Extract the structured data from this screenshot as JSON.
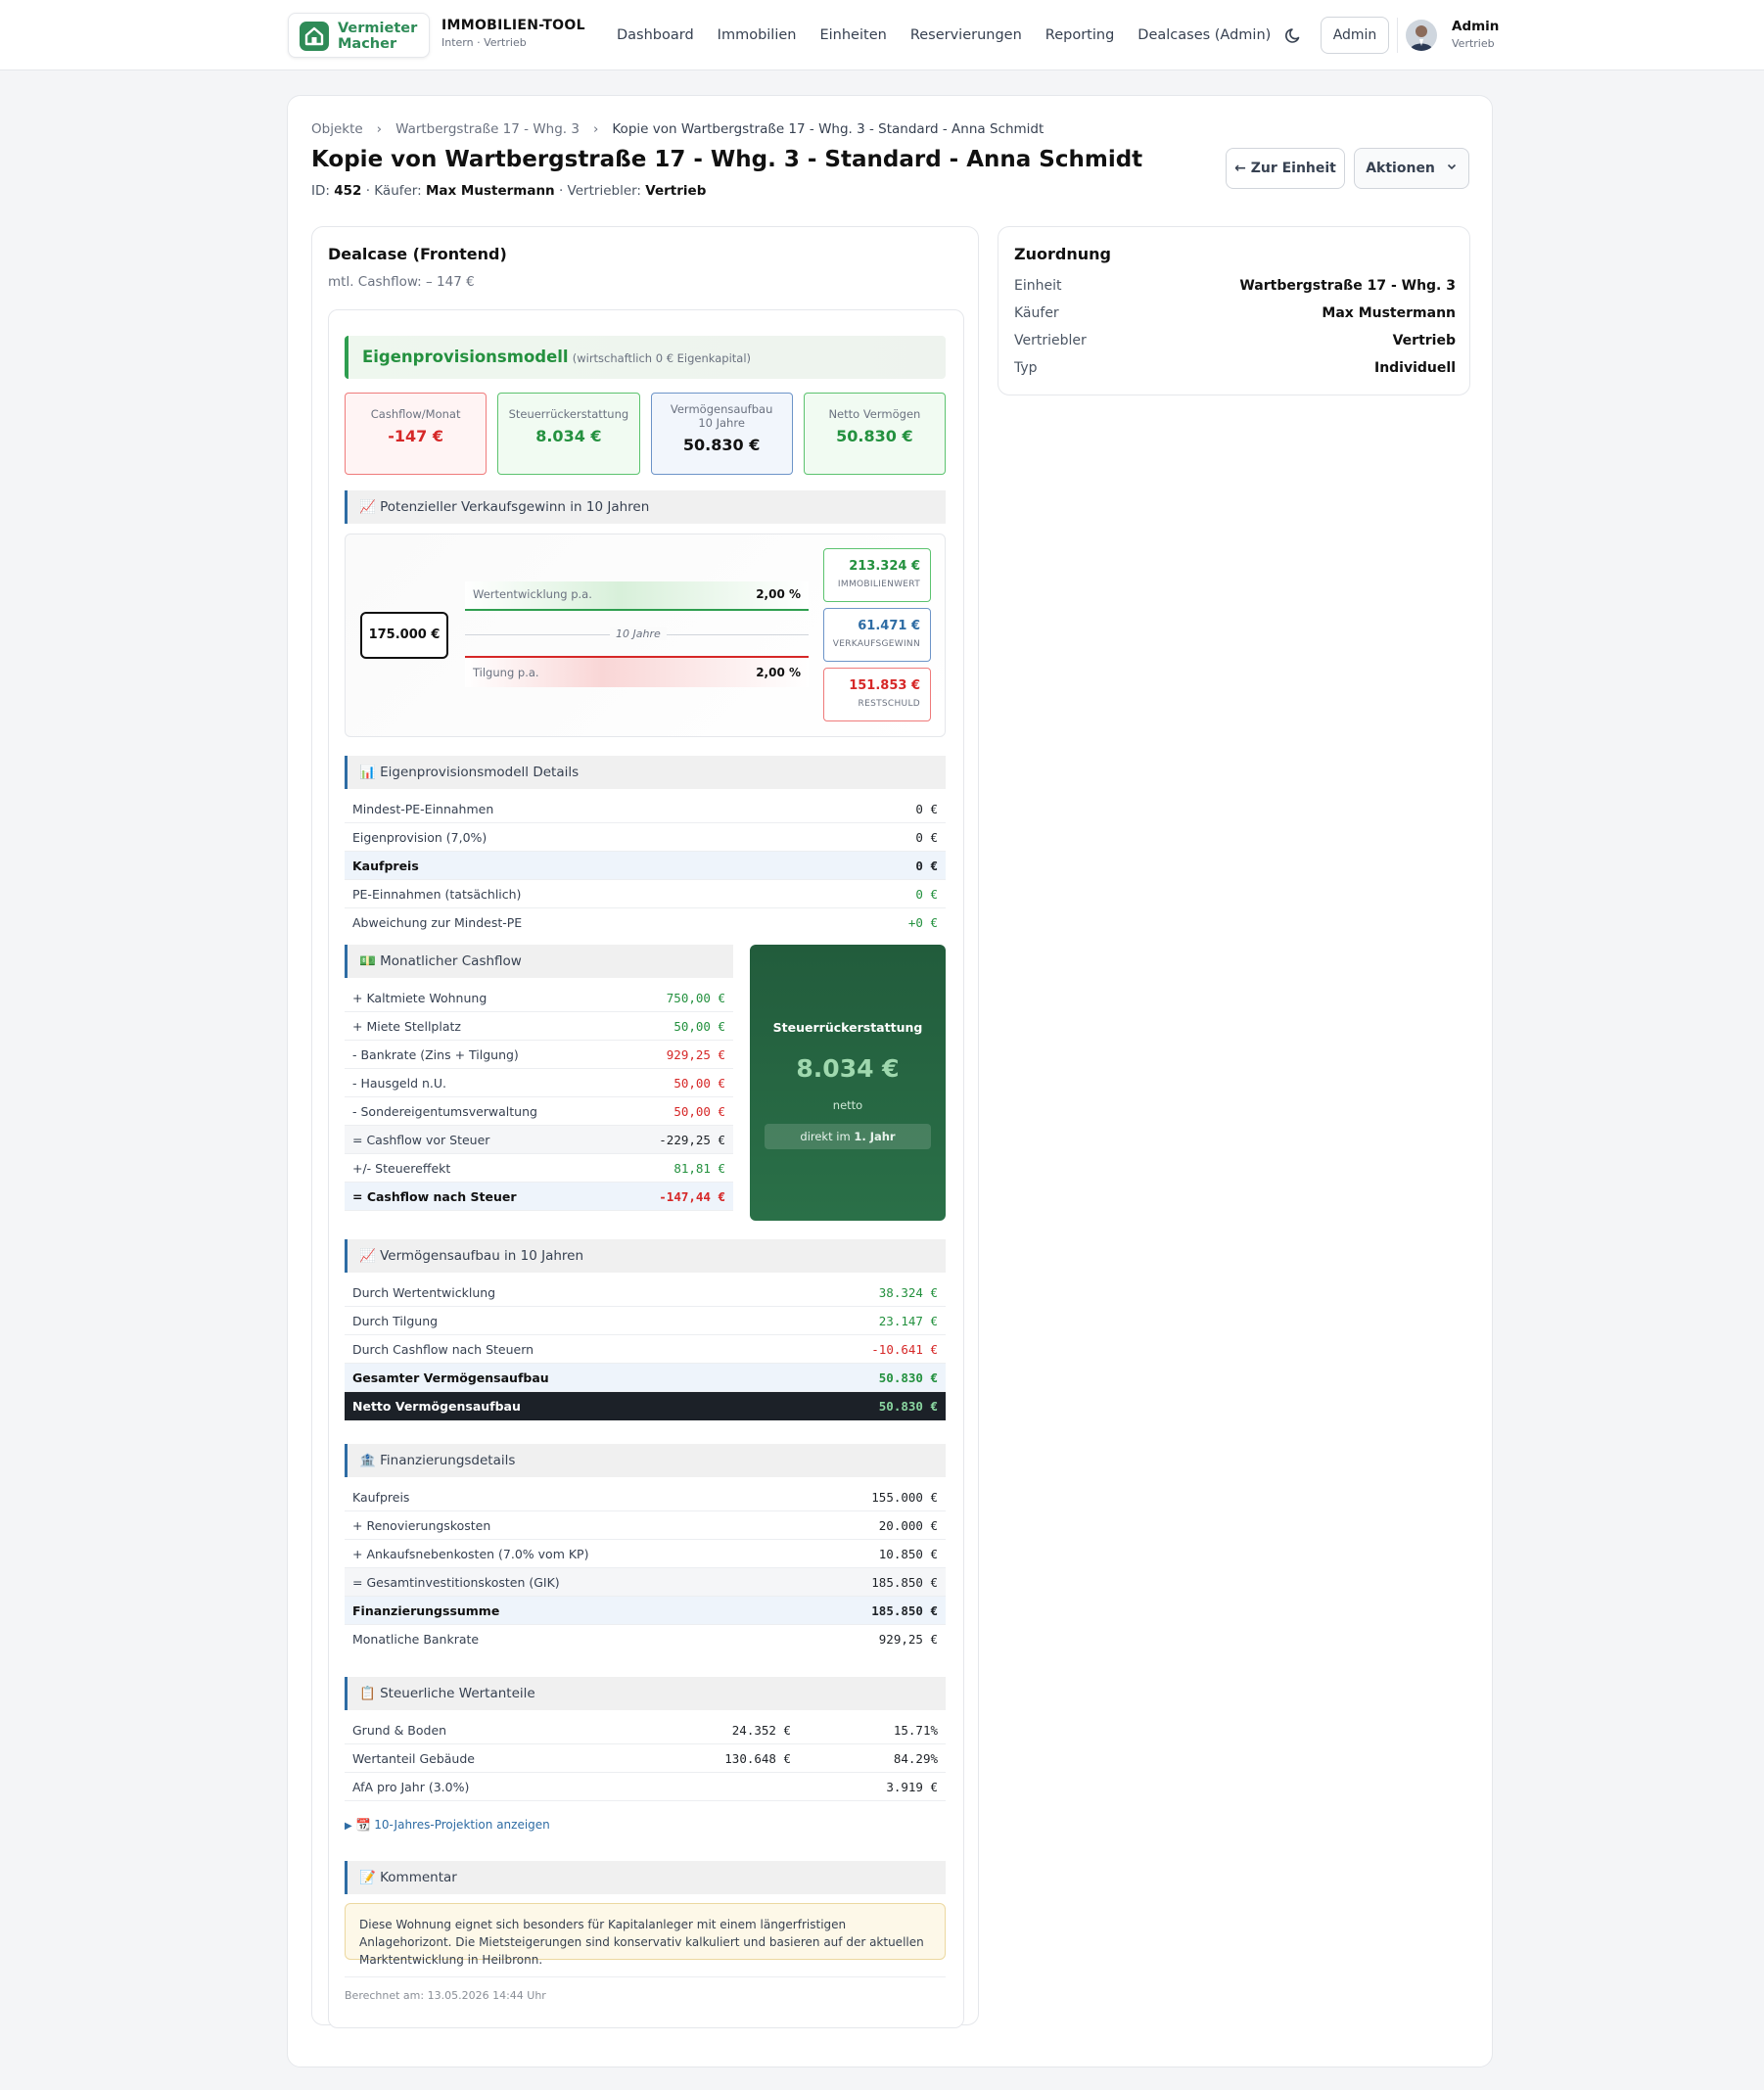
{
  "header": {
    "logo_line1": "Vermieter",
    "logo_line2": "Macher",
    "brand_title": "IMMOBILIEN-TOOL",
    "brand_sub": "Intern · Vertrieb",
    "nav": [
      "Dashboard",
      "Immobilien",
      "Einheiten",
      "Reservierungen",
      "Reporting",
      "Dealcases (Admin)"
    ],
    "admin_button": "Admin",
    "user_name": "Admin",
    "user_role": "Vertrieb"
  },
  "page": {
    "breadcrumbs": [
      "Objekte",
      "Wartbergstraße 17 - Whg. 3",
      "Kopie von Wartbergstraße 17 - Whg. 3 - Standard - Anna Schmidt"
    ],
    "title": "Kopie von Wartbergstraße 17 - Whg. 3 - Standard - Anna Schmidt",
    "meta_id_label": "ID:",
    "meta_id": "452",
    "meta_buyer_label": "· Käufer:",
    "meta_buyer": "Max Mustermann",
    "meta_seller_label": "· Vertriebler:",
    "meta_seller": "Vertrieb",
    "back_button": "← Zur Einheit",
    "actions_button": "Aktionen"
  },
  "dealcase": {
    "title": "Dealcase (Frontend)",
    "subtitle": "mtl. Cashflow: – 147 €",
    "hero_title": "Eigenprovisionsmodell",
    "hero_sub": "(wirtschaftlich 0 € Eigenkapital)",
    "kpis": [
      {
        "label": "Cashflow/Monat",
        "value": "-147 €"
      },
      {
        "label": "Steuerrückerstattung",
        "value": "8.034 €"
      },
      {
        "label": "Vermögensaufbau 10 Jahre",
        "value": "50.830 €"
      },
      {
        "label": "Netto Vermögen",
        "value": "50.830 €"
      }
    ],
    "projection": {
      "section": "📈 Potenzieller Verkaufsgewinn in 10 Jahren",
      "start_value": "175.000 €",
      "growth_label": "Wertentwicklung p.a.",
      "growth_value": "2,00 %",
      "years_label": "10 Jahre",
      "repay_label": "Tilgung p.a.",
      "repay_value": "2,00 %",
      "property_value": "213.324 €",
      "property_label": "IMMOBILIENWERT",
      "sale_gain": "61.471 €",
      "sale_gain_label": "VERKAUFSGEWINN",
      "remaining_debt": "151.853 €",
      "remaining_debt_label": "RESTSCHULD"
    },
    "ep_details": {
      "section": "📊 Eigenprovisionsmodell Details",
      "rows": [
        {
          "label": "Mindest-PE-Einnahmen",
          "value": "0 €"
        },
        {
          "label": "Eigenprovision (7,0%)",
          "value": "0 €"
        },
        {
          "label": "Kaufpreis",
          "value": "0 €"
        },
        {
          "label": "PE-Einnahmen (tatsächlich)",
          "value": "0 €"
        },
        {
          "label": "Abweichung zur Mindest-PE",
          "value": "+0 €"
        }
      ]
    },
    "cashflow": {
      "section": "💵 Monatlicher Cashflow",
      "rows": [
        {
          "label": "+ Kaltmiete Wohnung",
          "value": "750,00 €"
        },
        {
          "label": "+ Miete Stellplatz",
          "value": "50,00 €"
        },
        {
          "label": "- Bankrate (Zins + Tilgung)",
          "value": "929,25 €"
        },
        {
          "label": "- Hausgeld n.U.",
          "value": "50,00 €"
        },
        {
          "label": "- Sondereigentumsverwaltung",
          "value": "50,00 €"
        },
        {
          "label": "= Cashflow vor Steuer",
          "value": "-229,25 €"
        },
        {
          "label": "+/- Steuereffekt",
          "value": "81,81 €"
        },
        {
          "label": "= Cashflow nach Steuer",
          "value": "-147,44 €"
        }
      ],
      "tax_title": "Steuerrückerstattung",
      "tax_value": "8.034 €",
      "tax_sub": "netto",
      "tax_pill_prefix": "direkt im",
      "tax_pill_bold": "1. Jahr"
    },
    "wealth": {
      "section": "📈 Vermögensaufbau in 10 Jahren",
      "rows": [
        {
          "label": "Durch Wertentwicklung",
          "value": "38.324 €"
        },
        {
          "label": "Durch Tilgung",
          "value": "23.147 €"
        },
        {
          "label": "Durch Cashflow nach Steuern",
          "value": "-10.641 €"
        },
        {
          "label": "Gesamter Vermögensaufbau",
          "value": "50.830 €"
        },
        {
          "label": "Netto Vermögensaufbau",
          "value": "50.830 €"
        }
      ]
    },
    "financing": {
      "section": "🏦 Finanzierungsdetails",
      "rows": [
        {
          "label": "Kaufpreis",
          "value": "155.000 €"
        },
        {
          "label": "+ Renovierungskosten",
          "value": "20.000 €"
        },
        {
          "label": "+ Ankaufsnebenkosten (7.0% vom KP)",
          "value": "10.850 €"
        },
        {
          "label": "= Gesamtinvestitionskosten (GIK)",
          "value": "185.850 €"
        },
        {
          "label": "Finanzierungssumme",
          "value": "185.850 €"
        },
        {
          "label": "Monatliche Bankrate",
          "value": "929,25 €"
        }
      ]
    },
    "tax_shares": {
      "section": "📋 Steuerliche Wertanteile",
      "rows": [
        {
          "label": "Grund & Boden",
          "amount": "24.352 €",
          "pct": "15.71%"
        },
        {
          "label": "Wertanteil Gebäude",
          "amount": "130.648 €",
          "pct": "84.29%"
        },
        {
          "label": "AfA pro Jahr (3.0%)",
          "amount": "",
          "pct": "3.919 €"
        }
      ]
    },
    "projection_toggle": "📆 10-Jahres-Projektion anzeigen",
    "comment_section": "📝 Kommentar",
    "comment": "Diese Wohnung eignet sich besonders für Kapitalanleger mit einem längerfristigen Anlagehorizont. Die Mietsteigerungen sind konservativ kalkuliert und basieren auf der aktuellen Marktentwicklung in Heilbronn.",
    "calculated": "Berechnet am: 13.05.2026 14:44 Uhr"
  },
  "assignment": {
    "title": "Zuordnung",
    "rows": [
      {
        "label": "Einheit",
        "value": "Wartbergstraße 17 - Whg. 3"
      },
      {
        "label": "Käufer",
        "value": "Max Mustermann"
      },
      {
        "label": "Vertriebler",
        "value": "Vertrieb"
      },
      {
        "label": "Typ",
        "value": "Individuell"
      }
    ]
  },
  "colors": {
    "brand_green": "#2e8b57",
    "positive": "#24913f",
    "negative": "#d62828",
    "accent_blue": "#2e6ca4"
  }
}
